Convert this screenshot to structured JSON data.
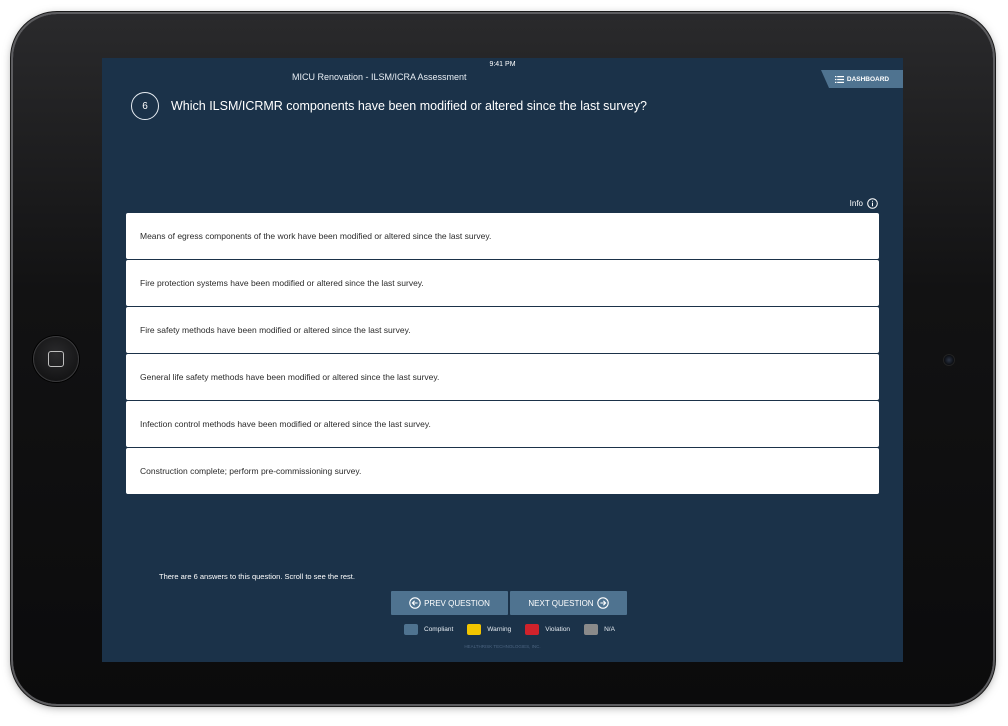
{
  "status_bar": {
    "time": "9:41 PM"
  },
  "header": {
    "assessment_title": "MICU Renovation - ILSM/ICRA Assessment",
    "dashboard_label": "DASHBOARD"
  },
  "question": {
    "number": "6",
    "text": "Which ILSM/ICRMR components have been modified or altered since the last survey?"
  },
  "info_label": "Info",
  "answers": [
    "Means of egress components of the work have been modified or altered since the last survey.",
    "Fire protection systems have been modified or altered since the last survey.",
    "Fire safety methods have been modified or altered since the last survey.",
    "General life safety methods have been modified or altered since the last survey.",
    "Infection control methods have been modified or altered since the last survey.",
    "Construction complete; perform pre-commissioning survey."
  ],
  "scroll_hint": "There are 6 answers to this question. Scroll to see the rest.",
  "navigation": {
    "prev_label": "PREV QUESTION",
    "next_label": "NEXT QUESTION"
  },
  "legend": [
    {
      "label": "Compliant",
      "color": "#4f7390"
    },
    {
      "label": "Warning",
      "color": "#f2c500"
    },
    {
      "label": "Violation",
      "color": "#d0222b"
    },
    {
      "label": "N/A",
      "color": "#8a8a8a"
    }
  ],
  "footer": "HEALTHRISK TECHNOLOGIES, INC."
}
